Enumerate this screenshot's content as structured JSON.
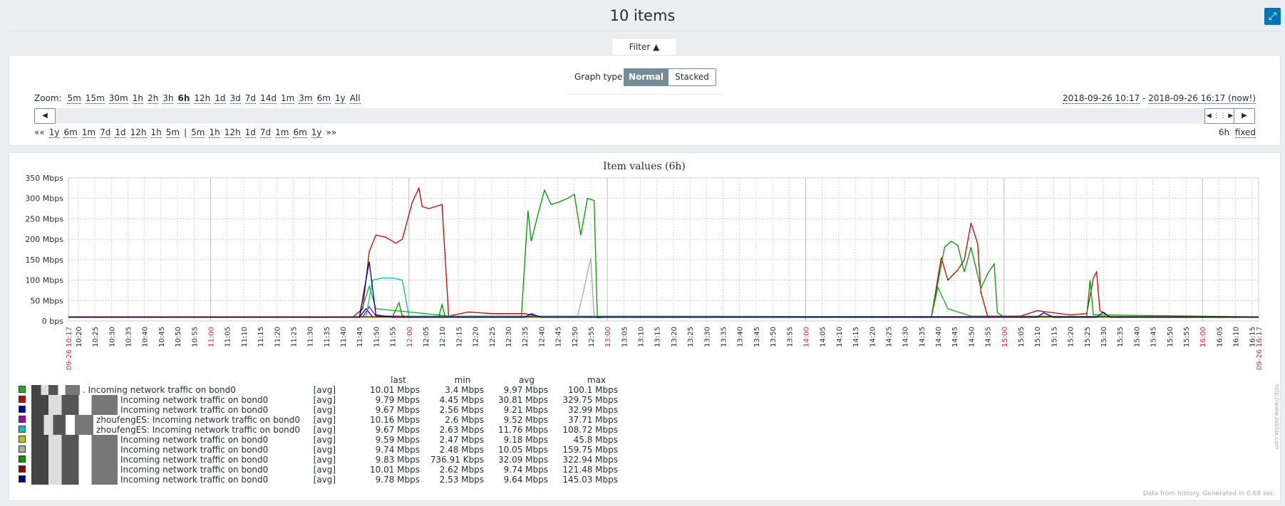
{
  "page": {
    "title": "10 items"
  },
  "filter": {
    "tab_label": "Filter ▲",
    "graph_type_label": "Graph type",
    "graph_type_options": [
      "Normal",
      "Stacked"
    ],
    "graph_type_selected": "Normal"
  },
  "timeselector": {
    "zoom_label": "Zoom:",
    "zoom_options": [
      "5m",
      "15m",
      "30m",
      "1h",
      "2h",
      "3h",
      "6h",
      "12h",
      "1d",
      "3d",
      "7d",
      "14d",
      "1m",
      "3m",
      "6m",
      "1y",
      "All"
    ],
    "zoom_active": "6h",
    "period_from": "2018-09-26 10:17",
    "period_sep": " - ",
    "period_to": "2018-09-26 16:17 (now!)",
    "nav_back_label": "««",
    "nav_back": [
      "1y",
      "6m",
      "1m",
      "7d",
      "1d",
      "12h",
      "1h",
      "5m"
    ],
    "nav_divider": "|",
    "nav_forward": [
      "5m",
      "1h",
      "12h",
      "1d",
      "7d",
      "1m",
      "6m",
      "1y"
    ],
    "nav_forward_label": "»»",
    "period_length": "6h",
    "fixed_label": "fixed"
  },
  "graph": {
    "footer": "Data from history. Generated in 0.68 sec.",
    "watermark": "http://www.zabbix.com",
    "x_start_label": "09-26 10:17",
    "x_end_label": "09-26 16:17",
    "x_ticks": [
      "10:20",
      "10:25",
      "10:30",
      "10:35",
      "10:40",
      "10:45",
      "10:50",
      "10:55",
      "11:00",
      "11:05",
      "11:10",
      "11:15",
      "11:20",
      "11:25",
      "11:30",
      "11:35",
      "11:40",
      "11:45",
      "11:50",
      "11:55",
      "12:00",
      "12:05",
      "12:10",
      "12:15",
      "12:20",
      "12:25",
      "12:30",
      "12:35",
      "12:40",
      "12:45",
      "12:50",
      "12:55",
      "13:00",
      "13:05",
      "13:10",
      "13:15",
      "13:20",
      "13:25",
      "13:30",
      "13:35",
      "13:40",
      "13:45",
      "13:50",
      "13:55",
      "14:00",
      "14:05",
      "14:10",
      "14:15",
      "14:20",
      "14:25",
      "14:30",
      "14:35",
      "14:40",
      "14:45",
      "14:50",
      "14:55",
      "15:00",
      "15:05",
      "15:10",
      "15:15",
      "15:20",
      "15:25",
      "15:30",
      "15:35",
      "15:40",
      "15:45",
      "15:50",
      "15:55",
      "16:00",
      "16:05",
      "16:10",
      "16:15"
    ],
    "highlight_color": "#e32d2d"
  },
  "chart_data": {
    "type": "line",
    "title": "Item values (6h)",
    "y_ticks": [
      "0 bps",
      "50 Mbps",
      "100 Mbps",
      "150 Mbps",
      "200 Mbps",
      "250 Mbps",
      "300 Mbps",
      "350 Mbps"
    ],
    "ylim": [
      0,
      350
    ],
    "y_unit": "Mbps",
    "xlim": [
      "10:17",
      "16:17"
    ],
    "grid": true,
    "series": [
      {
        "color": "#1aaf1a",
        "name": ". Incoming network traffic on bond0",
        "agg": "[avg]",
        "last": "10.01 Mbps",
        "min": "3.4 Mbps",
        "avg": "9.97 Mbps",
        "max": "100.1 Mbps",
        "points": [
          [
            "10:17",
            10
          ],
          [
            "11:45",
            10
          ],
          [
            "11:48",
            85
          ],
          [
            "11:50",
            30
          ],
          [
            "12:15",
            10
          ],
          [
            "14:38",
            10
          ],
          [
            "14:40",
            82
          ],
          [
            "14:43",
            30
          ],
          [
            "14:50",
            12
          ],
          [
            "16:17",
            10
          ]
        ]
      },
      {
        "color": "#c80000",
        "name": "Incoming network traffic on bond0",
        "agg": "[avg]",
        "last": "9.79 Mbps",
        "min": "4.45 Mbps",
        "avg": "30.81 Mbps",
        "max": "329.75 Mbps",
        "points": [
          [
            "10:17",
            9
          ],
          [
            "11:43",
            9
          ],
          [
            "11:46",
            30
          ],
          [
            "11:48",
            170
          ],
          [
            "11:50",
            210
          ],
          [
            "11:53",
            205
          ],
          [
            "11:56",
            190
          ],
          [
            "11:58",
            200
          ],
          [
            "12:00",
            260
          ],
          [
            "12:01",
            290
          ],
          [
            "12:03",
            325
          ],
          [
            "12:04",
            280
          ],
          [
            "12:06",
            275
          ],
          [
            "12:08",
            280
          ],
          [
            "12:10",
            285
          ],
          [
            "12:11",
            150
          ],
          [
            "12:12",
            12
          ],
          [
            "12:18",
            22
          ],
          [
            "12:25",
            18
          ],
          [
            "12:35",
            18
          ],
          [
            "12:40",
            10
          ],
          [
            "14:38",
            10
          ],
          [
            "14:41",
            155
          ],
          [
            "14:43",
            100
          ],
          [
            "14:46",
            125
          ],
          [
            "14:48",
            150
          ],
          [
            "14:50",
            240
          ],
          [
            "14:52",
            190
          ],
          [
            "14:53",
            70
          ],
          [
            "14:55",
            12
          ],
          [
            "15:05",
            12
          ],
          [
            "15:10",
            25
          ],
          [
            "15:15",
            20
          ],
          [
            "15:20",
            15
          ],
          [
            "15:25",
            18
          ],
          [
            "15:27",
            105
          ],
          [
            "15:28",
            120
          ],
          [
            "15:29",
            25
          ],
          [
            "15:32",
            10
          ],
          [
            "16:17",
            10
          ]
        ]
      },
      {
        "color": "#0000aa",
        "name": "Incoming network traffic on bond0",
        "agg": "[avg]",
        "last": "9.67 Mbps",
        "min": "2.56 Mbps",
        "avg": "9.21 Mbps",
        "max": "32.99 Mbps",
        "points": [
          [
            "10:17",
            9
          ],
          [
            "11:45",
            9
          ],
          [
            "11:47",
            30
          ],
          [
            "11:49",
            10
          ],
          [
            "16:17",
            9
          ]
        ]
      },
      {
        "color": "#aa00aa",
        "name": "zhoufengES: Incoming network traffic on bond0",
        "agg": "[avg]",
        "last": "10.16 Mbps",
        "min": "2.6 Mbps",
        "avg": "9.52 Mbps",
        "max": "37.71 Mbps",
        "points": [
          [
            "10:17",
            10
          ],
          [
            "11:46",
            10
          ],
          [
            "11:48",
            35
          ],
          [
            "11:50",
            12
          ],
          [
            "16:17",
            10
          ]
        ]
      },
      {
        "color": "#00c0c0",
        "name": "zhoufengES: Incoming network traffic on bond0",
        "agg": "[avg]",
        "last": "9.67 Mbps",
        "min": "2.63 Mbps",
        "avg": "11.76 Mbps",
        "max": "108.72 Mbps",
        "points": [
          [
            "10:17",
            10
          ],
          [
            "11:47",
            10
          ],
          [
            "11:49",
            100
          ],
          [
            "11:52",
            105
          ],
          [
            "11:55",
            105
          ],
          [
            "11:58",
            100
          ],
          [
            "12:00",
            12
          ],
          [
            "16:17",
            10
          ]
        ]
      },
      {
        "color": "#c0c000",
        "name": "Incoming network traffic on bond0",
        "agg": "[avg]",
        "last": "9.59 Mbps",
        "min": "2.47 Mbps",
        "avg": "9.18 Mbps",
        "max": "45.8 Mbps",
        "points": [
          [
            "10:17",
            9
          ],
          [
            "11:57",
            9
          ],
          [
            "11:58",
            15
          ],
          [
            "12:00",
            9
          ],
          [
            "16:17",
            9
          ]
        ]
      },
      {
        "color": "#a8a8a8",
        "name": "Incoming network traffic on bond0",
        "agg": "[avg]",
        "last": "9.74 Mbps",
        "min": "2.48 Mbps",
        "avg": "10.05 Mbps",
        "max": "159.75 Mbps",
        "points": [
          [
            "10:17",
            10
          ],
          [
            "12:51",
            10
          ],
          [
            "12:53",
            80
          ],
          [
            "12:55",
            155
          ],
          [
            "12:56",
            10
          ],
          [
            "16:17",
            10
          ]
        ]
      },
      {
        "color": "#009600",
        "name": "Incoming network traffic on bond0",
        "agg": "[avg]",
        "last": "9.83 Mbps",
        "min": "736.91 Kbps",
        "avg": "32.09 Mbps",
        "max": "322.94 Mbps",
        "points": [
          [
            "10:17",
            10
          ],
          [
            "11:55",
            10
          ],
          [
            "11:57",
            45
          ],
          [
            "11:58",
            10
          ],
          [
            "12:09",
            10
          ],
          [
            "12:10",
            40
          ],
          [
            "12:11",
            10
          ],
          [
            "12:34",
            10
          ],
          [
            "12:36",
            270
          ],
          [
            "12:37",
            195
          ],
          [
            "12:39",
            260
          ],
          [
            "12:41",
            320
          ],
          [
            "12:43",
            285
          ],
          [
            "12:45",
            290
          ],
          [
            "12:48",
            300
          ],
          [
            "12:50",
            310
          ],
          [
            "12:52",
            210
          ],
          [
            "12:54",
            300
          ],
          [
            "12:56",
            295
          ],
          [
            "12:57",
            8
          ],
          [
            "13:00",
            10
          ],
          [
            "14:38",
            10
          ],
          [
            "14:42",
            180
          ],
          [
            "14:44",
            195
          ],
          [
            "14:46",
            185
          ],
          [
            "14:48",
            120
          ],
          [
            "14:50",
            180
          ],
          [
            "14:53",
            80
          ],
          [
            "14:55",
            115
          ],
          [
            "14:57",
            140
          ],
          [
            "14:58",
            20
          ],
          [
            "15:00",
            10
          ],
          [
            "15:25",
            10
          ],
          [
            "15:26",
            100
          ],
          [
            "15:27",
            15
          ],
          [
            "16:17",
            10
          ]
        ]
      },
      {
        "color": "#960000",
        "name": "Incoming network traffic on bond0",
        "agg": "[avg]",
        "last": "10.01 Mbps",
        "min": "2.62 Mbps",
        "avg": "9.74 Mbps",
        "max": "121.48 Mbps",
        "points": [
          [
            "10:17",
            10
          ],
          [
            "16:17",
            10
          ]
        ]
      },
      {
        "color": "#000096",
        "name": "Incoming network traffic on bond0",
        "agg": "[avg]",
        "last": "9.78 Mbps",
        "min": "2.53 Mbps",
        "avg": "9.64 Mbps",
        "max": "145.03 Mbps",
        "points": [
          [
            "10:17",
            9
          ],
          [
            "11:45",
            9
          ],
          [
            "11:48",
            145
          ],
          [
            "11:50",
            15
          ],
          [
            "11:55",
            9
          ],
          [
            "12:35",
            9
          ],
          [
            "12:37",
            18
          ],
          [
            "12:40",
            9
          ],
          [
            "15:10",
            9
          ],
          [
            "15:12",
            20
          ],
          [
            "15:15",
            9
          ],
          [
            "15:28",
            9
          ],
          [
            "15:30",
            22
          ],
          [
            "15:32",
            9
          ],
          [
            "16:17",
            9
          ]
        ]
      }
    ],
    "legend_headers": [
      "last",
      "min",
      "avg",
      "max"
    ]
  }
}
